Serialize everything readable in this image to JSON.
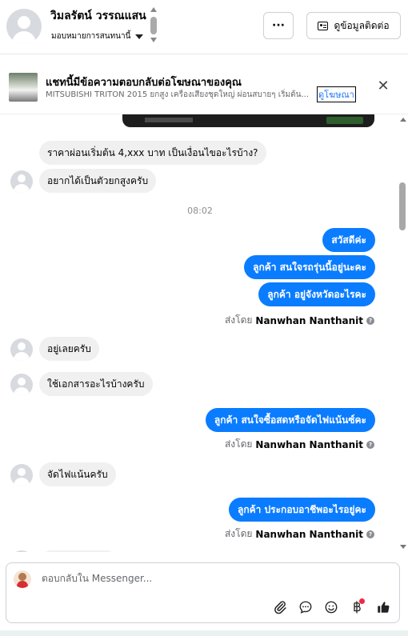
{
  "header": {
    "contact_name": "วิมลรัตน์ วรรณแสน",
    "assign_label": "มอบหมายการสนทนานี้",
    "more_label": "···",
    "contact_info_label": "ดูข้อมูลติดต่อ"
  },
  "ad": {
    "title": "แชทนี้มีข้อความตอบกลับต่อโฆษณาของคุณ",
    "description": "MITSUBISHI TRITON 2015 ยกสูง เครื่องเสียงชุดใหญ่ ผ่อนสบายๆ เริ่มต้น...",
    "link_label": "ดูโฆษณา",
    "close_label": "✕"
  },
  "messages": {
    "in_1": "ราคาผ่อนเริ่มต้น 4,xxx บาท เป็นเงื่อนไขอะไรบ้าง?",
    "in_2": "อยากได้เป็นตัวยกสูงครับ",
    "time_1": "08:02",
    "out_1": "สวัสดีค่ะ",
    "out_2": "ลูกค้า สนใจรถรุ่นนี้อยู่นะคะ",
    "out_3": "ลูกค้า อยู่จังหวัดอะไรคะ",
    "sent_by_label": "ส่งโดย",
    "sender": "Nanwhan Nanthanit",
    "in_3": "อยู่เลยครับ",
    "in_4": "ใช้เอกสารอะไรบ้างครับ",
    "out_4": "ลูกค้า สนใจซื้อสดหรือจัดไฟแน้นซ์คะ",
    "in_5": "จัดไฟแน้นครับ",
    "out_5": "ลูกค้า ประกอบอาชีพอะไรอยู่คะ"
  },
  "composer": {
    "placeholder": "ตอบกลับใน Messenger...",
    "icons": [
      "paperclip-icon",
      "chat-bubble-icon",
      "smiley-icon",
      "baht-icon",
      "thumbs-up-icon"
    ]
  },
  "colors": {
    "accent": "#0a7cff",
    "incoming_bubble": "#f0f0f0",
    "badge": "#f02849"
  }
}
